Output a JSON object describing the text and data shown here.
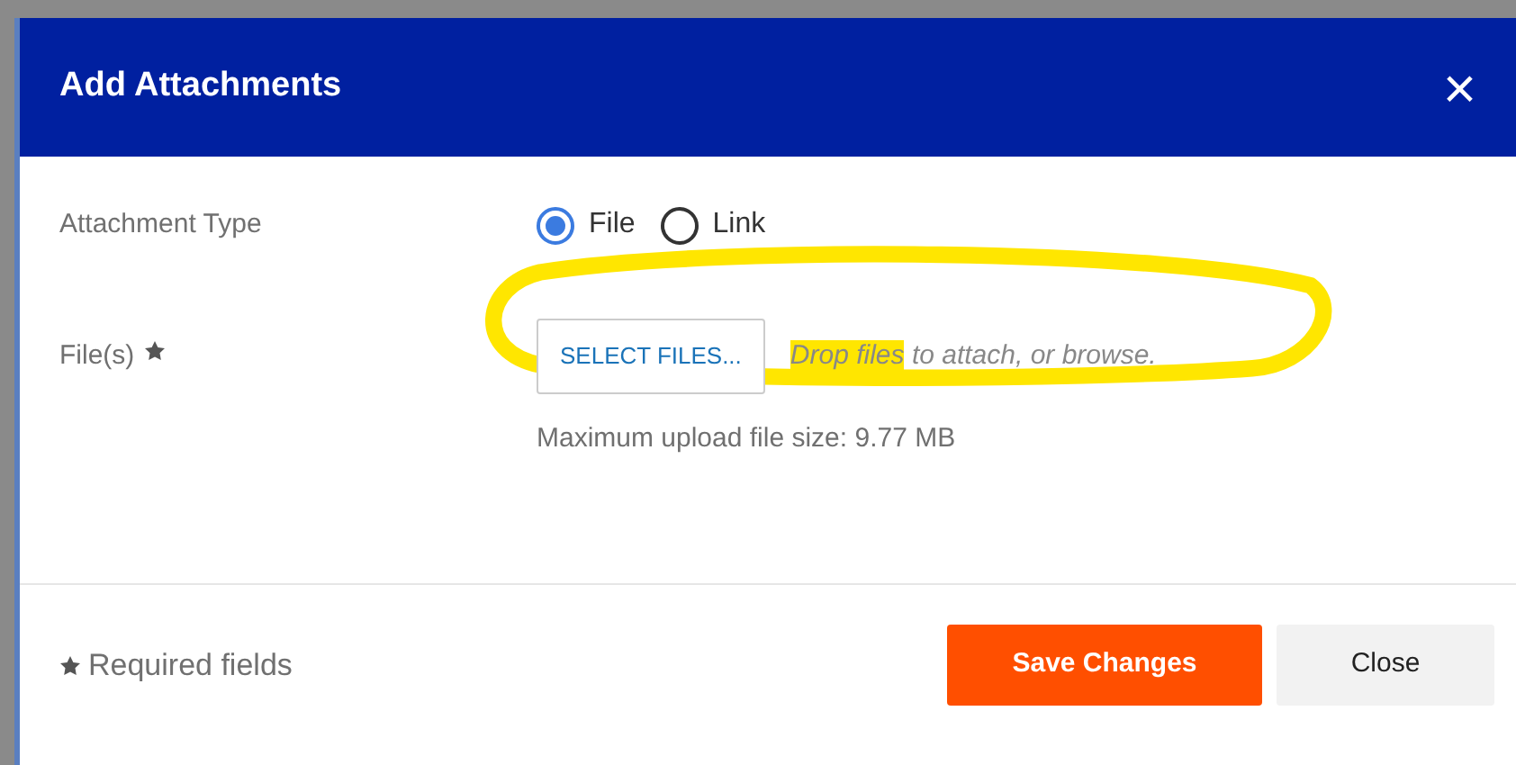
{
  "dialog": {
    "title": "Add Attachments",
    "close_icon": "×"
  },
  "attachment_type": {
    "label": "Attachment Type",
    "options": [
      {
        "label": "File",
        "selected": true
      },
      {
        "label": "Link",
        "selected": false
      }
    ]
  },
  "files": {
    "label": "File(s)",
    "required": true,
    "button": "SELECT FILES...",
    "circled": true,
    "hint": [
      {
        "text": "Drop files",
        "highlighted": true
      },
      {
        "text": " to attach, or browse.",
        "highlighted": false
      }
    ],
    "note": "Maximum upload file size: 9.77 MB"
  },
  "footer": {
    "required_note": "Required fields",
    "buttons": [
      {
        "label": "Save Changes",
        "kind": "primary"
      },
      {
        "label": "Close",
        "kind": "secondary"
      }
    ]
  }
}
